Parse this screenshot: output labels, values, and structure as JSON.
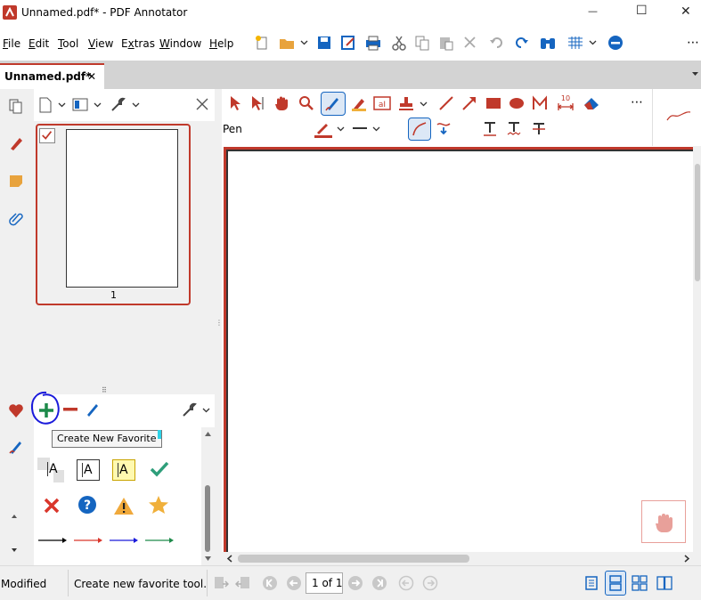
{
  "window": {
    "title": "Unnamed.pdf* - PDF Annotator",
    "minimize": "—",
    "maximize": "☐",
    "close": "✕"
  },
  "menu": {
    "items": [
      {
        "label": "File",
        "mn": "F"
      },
      {
        "label": "Edit",
        "mn": "E"
      },
      {
        "label": "Tool",
        "mn": "T"
      },
      {
        "label": "View",
        "mn": "V"
      },
      {
        "label": "Extras",
        "mn": "x"
      },
      {
        "label": "Window",
        "mn": "W"
      },
      {
        "label": "Help",
        "mn": "H"
      }
    ],
    "more": "⋯"
  },
  "doc_tab": {
    "label": "Unnamed.pdf*",
    "close": "✕"
  },
  "tool_options": {
    "tool_name": "Pen"
  },
  "thumbnails": [
    {
      "page_label": "1"
    }
  ],
  "favorites": {
    "tooltip": "Create New Favorite",
    "text_samples": [
      "A",
      "A",
      "A"
    ]
  },
  "status": {
    "state": "Modified",
    "message": "Create new favorite tool.",
    "page_indicator": "1 of 1"
  },
  "colors": {
    "accent_red": "#c0392b",
    "pen_blue": "#1565c0",
    "favorite_green": "#1d8a4a",
    "active_border": "#c0392b"
  }
}
